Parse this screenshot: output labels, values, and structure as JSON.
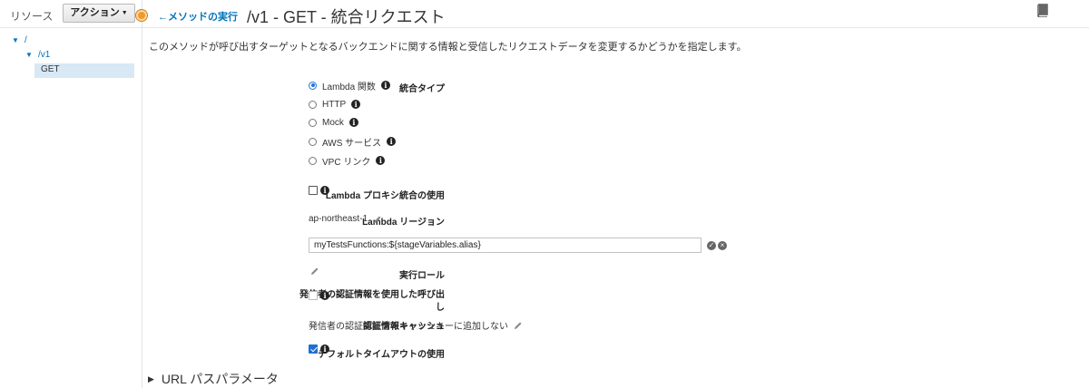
{
  "sidebar": {
    "title": "リソース",
    "action_label": "アクション",
    "tree": [
      {
        "label": "/"
      },
      {
        "label": "/v1"
      },
      {
        "label": "GET"
      }
    ]
  },
  "header": {
    "back_link": "メソッドの実行",
    "title": "/v1 - GET - 統合リクエスト"
  },
  "description": "このメソッドが呼び出すターゲットとなるバックエンドに関する情報と受信したリクエストデータを変更するかどうかを指定します。",
  "form": {
    "integration_type_label": "統合タイプ",
    "integration_options": [
      {
        "label": "Lambda 関数",
        "selected": true
      },
      {
        "label": "HTTP",
        "selected": false
      },
      {
        "label": "Mock",
        "selected": false
      },
      {
        "label": "AWS サービス",
        "selected": false
      },
      {
        "label": "VPC リンク",
        "selected": false
      }
    ],
    "proxy_label": "Lambda プロキシ統合の使用",
    "proxy_checked": false,
    "region_label": "Lambda リージョン",
    "region_value": "ap-northeast-1",
    "function_label": "Lambda 関数",
    "function_value": "myTestsFunctions:${stageVariables.alias}",
    "role_label": "実行ロール",
    "caller_creds_label_1": "発信者の認証情報を使用した呼び出",
    "caller_creds_label_2": "し",
    "caller_creds_checked": false,
    "cache_label": "認証情報キャッシュ",
    "cache_value": "発信者の認証情報をキャッシュキーに追加しない",
    "timeout_label": "デフォルトタイムアウトの使用",
    "timeout_checked": true
  },
  "sections": {
    "url_path_params": "URL パスパラメータ"
  },
  "colors": {
    "link": "#0073bb",
    "accent_orange": "#ec9b2c",
    "checkbox_blue": "#1f6fd1"
  },
  "icons": {
    "info": "info-icon",
    "pencil": "pencil-icon",
    "book": "book-icon",
    "confirm": "check-circle-icon",
    "cancel": "x-circle-icon"
  }
}
